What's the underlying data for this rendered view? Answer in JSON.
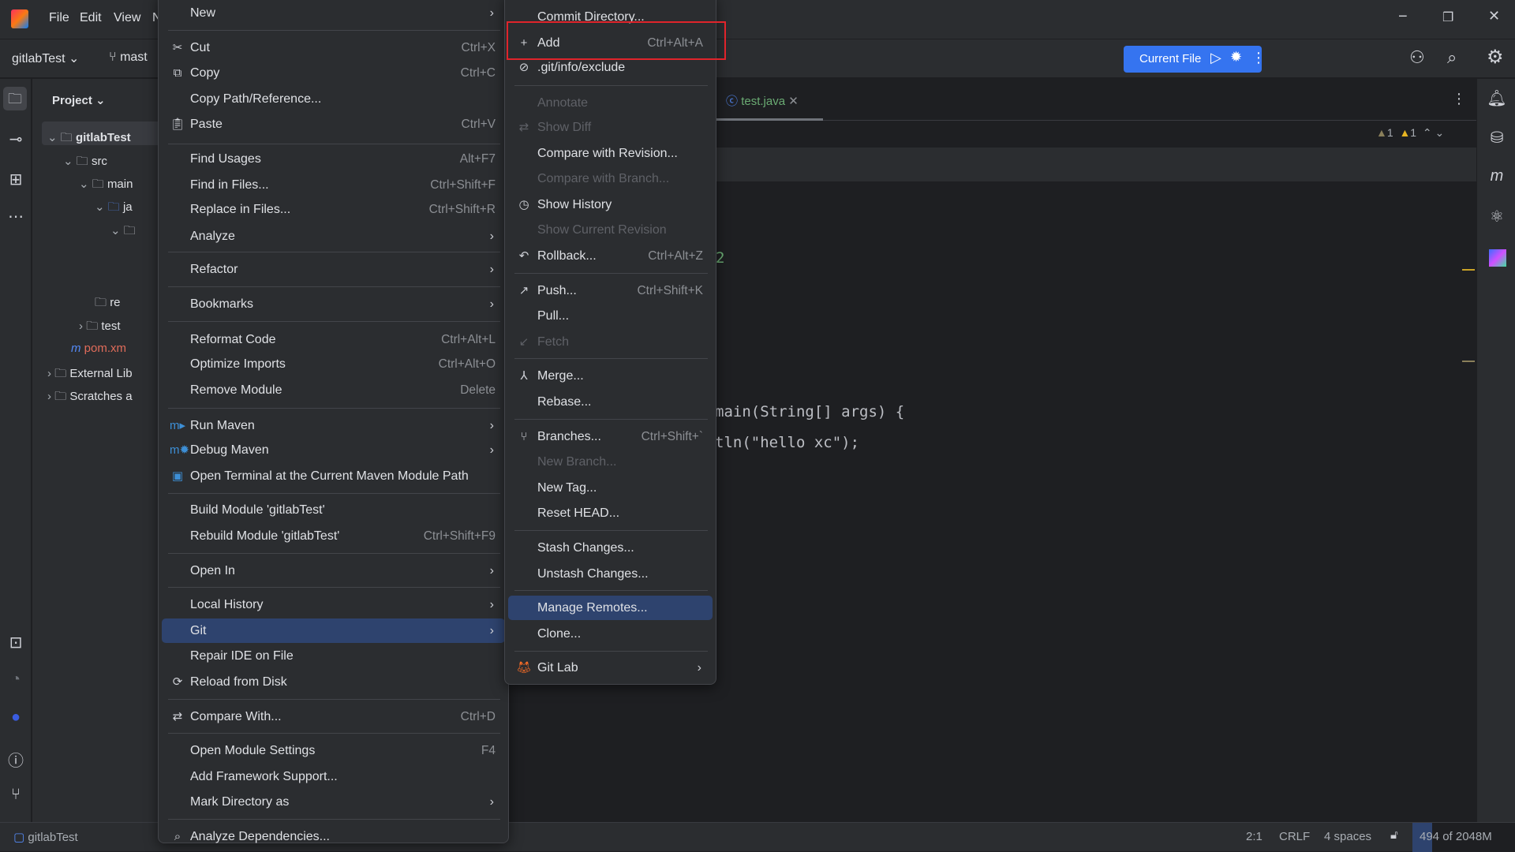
{
  "menubar": [
    "File",
    "Edit",
    "View",
    "N"
  ],
  "toolbar": {
    "project": "gitlabTest",
    "branch": "mast",
    "run_config": "Current File"
  },
  "project_panel": {
    "title": "Project",
    "items": [
      {
        "label": "gitlabTest",
        "depth": 0,
        "bold": true
      },
      {
        "label": "src",
        "depth": 1
      },
      {
        "label": "main",
        "depth": 2
      },
      {
        "label": "ja",
        "depth": 3
      },
      {
        "label": "",
        "depth": 4
      },
      {
        "label": "re",
        "depth": 4
      },
      {
        "label": "test",
        "depth": 2
      },
      {
        "label": "pom.xm",
        "depth": 2
      },
      {
        "label": "External Lib",
        "depth": 0
      },
      {
        "label": "Scratches a",
        "depth": 0
      }
    ]
  },
  "editor": {
    "tab": "test.java",
    "warnings": [
      "1",
      "1"
    ],
    "code": [
      {
        "text": "2",
        "color": "#6aab73"
      },
      {
        "text": "main(String[] args) {",
        "color": "#bcbec4"
      },
      {
        "text": "tln(\"hello xc\");",
        "color": "#bcbec4"
      }
    ]
  },
  "context_menu": {
    "items": [
      {
        "label": "New",
        "arrow": true
      },
      {
        "sep": true
      },
      {
        "label": "Cut",
        "shortcut": "Ctrl+X",
        "icon": "scissors-icon"
      },
      {
        "label": "Copy",
        "shortcut": "Ctrl+C",
        "icon": "copy-icon"
      },
      {
        "label": "Copy Path/Reference..."
      },
      {
        "label": "Paste",
        "shortcut": "Ctrl+V",
        "icon": "paste-icon"
      },
      {
        "sep": true
      },
      {
        "label": "Find Usages",
        "shortcut": "Alt+F7"
      },
      {
        "label": "Find in Files...",
        "shortcut": "Ctrl+Shift+F"
      },
      {
        "label": "Replace in Files...",
        "shortcut": "Ctrl+Shift+R"
      },
      {
        "label": "Analyze",
        "arrow": true
      },
      {
        "sep": true
      },
      {
        "label": "Refactor",
        "arrow": true
      },
      {
        "sep": true
      },
      {
        "label": "Bookmarks",
        "arrow": true
      },
      {
        "sep": true
      },
      {
        "label": "Reformat Code",
        "shortcut": "Ctrl+Alt+L"
      },
      {
        "label": "Optimize Imports",
        "shortcut": "Ctrl+Alt+O"
      },
      {
        "label": "Remove Module",
        "shortcut": "Delete"
      },
      {
        "sep": true
      },
      {
        "label": "Run Maven",
        "arrow": true,
        "icon": "maven-run-icon"
      },
      {
        "label": "Debug Maven",
        "arrow": true,
        "icon": "maven-debug-icon"
      },
      {
        "label": "Open Terminal at the Current Maven Module Path",
        "icon": "maven-terminal-icon"
      },
      {
        "sep": true
      },
      {
        "label": "Build Module 'gitlabTest'"
      },
      {
        "label": "Rebuild Module 'gitlabTest'",
        "shortcut": "Ctrl+Shift+F9"
      },
      {
        "sep": true
      },
      {
        "label": "Open In",
        "arrow": true
      },
      {
        "sep": true
      },
      {
        "label": "Local History",
        "arrow": true
      },
      {
        "label": "Git",
        "arrow": true,
        "selected": true
      },
      {
        "label": "Repair IDE on File"
      },
      {
        "label": "Reload from Disk",
        "icon": "reload-icon"
      },
      {
        "sep": true
      },
      {
        "label": "Compare With...",
        "shortcut": "Ctrl+D",
        "icon": "compare-icon"
      },
      {
        "sep": true
      },
      {
        "label": "Open Module Settings",
        "shortcut": "F4"
      },
      {
        "label": "Add Framework Support..."
      },
      {
        "label": "Mark Directory as",
        "arrow": true
      },
      {
        "sep": true
      },
      {
        "label": "Analyze Dependencies...",
        "icon": "analyze-icon"
      }
    ]
  },
  "git_submenu": {
    "items": [
      {
        "label": "Commit Directory..."
      },
      {
        "label": "Add",
        "shortcut": "Ctrl+Alt+A",
        "icon": "plus-icon",
        "highlighted_box": true
      },
      {
        "label": ".git/info/exclude",
        "icon": "ignore-icon"
      },
      {
        "sep": true
      },
      {
        "label": "Annotate",
        "disabled": true
      },
      {
        "label": "Show Diff",
        "disabled": true,
        "icon": "diff-icon"
      },
      {
        "label": "Compare with Revision..."
      },
      {
        "label": "Compare with Branch...",
        "disabled": true
      },
      {
        "label": "Show History",
        "icon": "clock-icon"
      },
      {
        "label": "Show Current Revision",
        "disabled": true
      },
      {
        "label": "Rollback...",
        "shortcut": "Ctrl+Alt+Z",
        "icon": "rollback-icon"
      },
      {
        "sep": true
      },
      {
        "label": "Push...",
        "shortcut": "Ctrl+Shift+K",
        "icon": "push-icon"
      },
      {
        "label": "Pull..."
      },
      {
        "label": "Fetch",
        "disabled": true,
        "icon": "fetch-icon"
      },
      {
        "sep": true
      },
      {
        "label": "Merge...",
        "icon": "merge-icon"
      },
      {
        "label": "Rebase..."
      },
      {
        "sep": true
      },
      {
        "label": "Branches...",
        "shortcut": "Ctrl+Shift+`",
        "icon": "branch-icon"
      },
      {
        "label": "New Branch...",
        "disabled": true
      },
      {
        "label": "New Tag..."
      },
      {
        "label": "Reset HEAD..."
      },
      {
        "sep": true
      },
      {
        "label": "Stash Changes..."
      },
      {
        "label": "Unstash Changes..."
      },
      {
        "sep": true
      },
      {
        "label": "Manage Remotes...",
        "selected": true
      },
      {
        "label": "Clone..."
      },
      {
        "sep": true
      },
      {
        "label": "Git Lab",
        "arrow": true,
        "icon": "gitlab-icon"
      }
    ]
  },
  "statusbar": {
    "project": "gitlabTest",
    "position": "2:1",
    "line_ending": "CRLF",
    "indent": "4 spaces",
    "memory": "494 of 2048M",
    "memory_used_fraction": 0.24
  },
  "colors": {
    "accent": "#3574f0",
    "selection": "#2e436e",
    "highlight_box": "#e0242b"
  }
}
